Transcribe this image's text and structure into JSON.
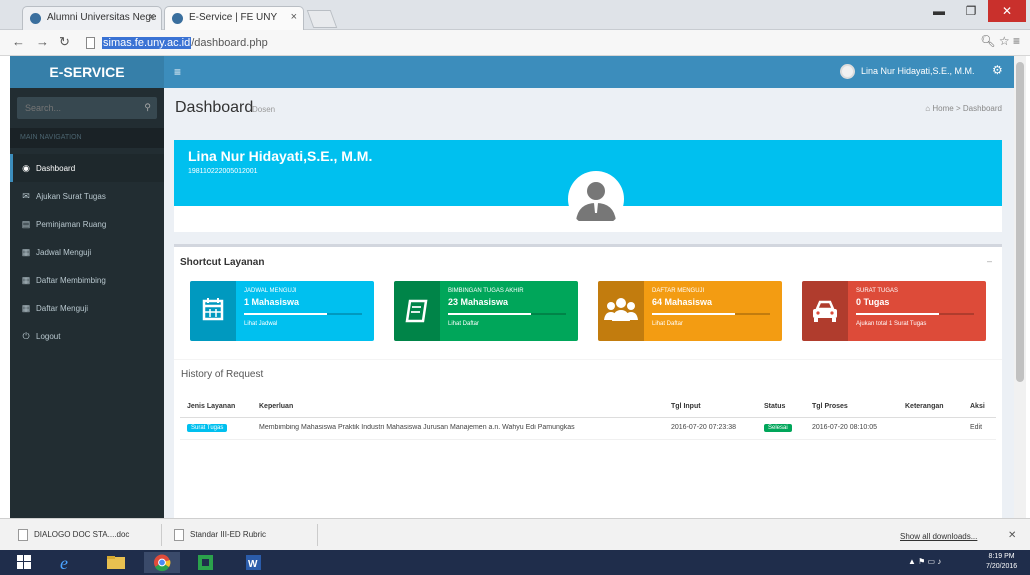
{
  "browser": {
    "tabs": [
      {
        "title": "Alumni Universitas Nege"
      },
      {
        "title": "E-Service | FE UNY"
      }
    ],
    "url_host": "simas.fe.uny.ac.id",
    "url_path": "/dashboard.php"
  },
  "app": {
    "brand": "E-SERVICE",
    "user_name": "Lina Nur Hidayati,S.E., M.M."
  },
  "sidebar": {
    "search_placeholder": "Search...",
    "header": "MAIN NAVIGATION",
    "items": [
      {
        "label": "Dashboard",
        "icon": "dashboard-icon",
        "active": true
      },
      {
        "label": "Ajukan Surat Tugas",
        "icon": "envelope-icon"
      },
      {
        "label": "Peminjaman Ruang",
        "icon": "building-icon"
      },
      {
        "label": "Jadwal Menguji",
        "icon": "calendar-icon"
      },
      {
        "label": "Daftar Membimbing",
        "icon": "calendar-icon"
      },
      {
        "label": "Daftar Menguji",
        "icon": "calendar-icon"
      },
      {
        "label": "Logout",
        "icon": "power-icon"
      }
    ]
  },
  "page": {
    "title": "Dashboard",
    "subtitle": "Dosen",
    "breadcrumb_home": "Home",
    "breadcrumb_current": "Dashboard"
  },
  "profile": {
    "name": "Lina Nur Hidayati,S.E., M.M.",
    "nip": "198110222005012001"
  },
  "shortcut": {
    "title": "Shortcut Layanan",
    "boxes": [
      {
        "label": "JADWAL MENGUJI",
        "value": "1 Mahasiswa",
        "desc": "Lihat Jadwal",
        "color": "#00c0ef",
        "icon": "calendar-icon"
      },
      {
        "label": "BIMBINGAN TUGAS AKHIR",
        "value": "23 Mahasiswa",
        "desc": "Lihat Daftar",
        "color": "#00a65a",
        "icon": "book-icon"
      },
      {
        "label": "DAFTAR MENGUJI",
        "value": "64 Mahasiswa",
        "desc": "Lihat Daftar",
        "color": "#f39c12",
        "icon": "users-icon"
      },
      {
        "label": "SURAT TUGAS",
        "value": "0 Tugas",
        "desc": "Ajukan total 1 Surat Tugas",
        "color": "#dd4b39",
        "icon": "car-icon"
      }
    ]
  },
  "history": {
    "title": "History of Request",
    "columns": [
      "Jenis Layanan",
      "Keperluan",
      "Tgl Input",
      "Status",
      "Tgl Proses",
      "Keterangan",
      "Aksi"
    ],
    "rows": [
      {
        "jenis": "Surat Tugas",
        "keperluan": "Membimbing Mahasiswa Praktik Industri Mahasiswa Jurusan Manajemen a.n. Wahyu Edi Pamungkas",
        "tgl_input": "2016-07-20 07:23:38",
        "status": "Selesai",
        "tgl_proses": "2016-07-20 08:10:05",
        "keterangan": "",
        "aksi": "Edit"
      }
    ]
  },
  "downloads": {
    "items": [
      {
        "name": "DIALOGO DOC STA....doc"
      },
      {
        "name": "Standar III-ED Rubric"
      }
    ],
    "show_all": "Show all downloads..."
  },
  "taskbar": {
    "time": "8:19 PM",
    "date": "7/20/2016"
  },
  "colors": {
    "brand": "#367fa9",
    "header": "#3c8dbc",
    "sidebar": "#222d32",
    "profile_banner": "#00c0ef"
  }
}
